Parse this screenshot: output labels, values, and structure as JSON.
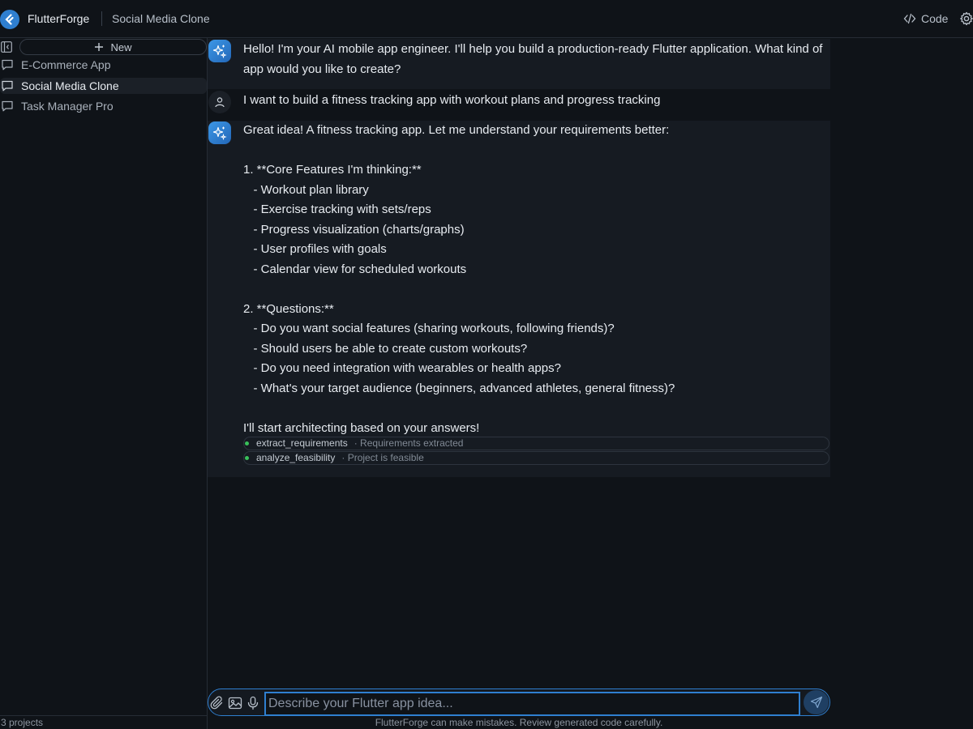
{
  "header": {
    "app_name": "FlutterForge",
    "project_title": "Social Media Clone",
    "code_label": "Code"
  },
  "sidebar": {
    "new_label": "New",
    "projects": [
      {
        "label": "E-Commerce App",
        "active": false
      },
      {
        "label": "Social Media Clone",
        "active": true
      },
      {
        "label": "Task Manager Pro",
        "active": false
      }
    ],
    "footer": "3 projects"
  },
  "messages": [
    {
      "role": "ai",
      "text": "Hello! I'm your AI mobile app engineer. I'll help you build a production-ready Flutter application. What kind of app would you like to create?"
    },
    {
      "role": "user",
      "text": "I want to build a fitness tracking app with workout plans and progress tracking"
    },
    {
      "role": "ai",
      "text": "Great idea! A fitness tracking app. Let me understand your requirements better:\n\n1. **Core Features I'm thinking:**\n   - Workout plan library\n   - Exercise tracking with sets/reps\n   - Progress visualization (charts/graphs)\n   - User profiles with goals\n   - Calendar view for scheduled workouts\n\n2. **Questions:**\n   - Do you want social features (sharing workouts, following friends)?\n   - Should users be able to create custom workouts?\n   - Do you need integration with wearables or health apps?\n   - What's your target audience (beginners, advanced athletes, general fitness)?\n\nI'll start architecting based on your answers!"
    }
  ],
  "tools": [
    {
      "name": "extract_requirements",
      "result": "· Requirements extracted"
    },
    {
      "name": "analyze_feasibility",
      "result": "· Project is feasible"
    }
  ],
  "composer": {
    "placeholder": "Describe your Flutter app idea...",
    "value": ""
  },
  "disclaimer": "FlutterForge can make mistakes. Review generated code carefully.",
  "colors": {
    "accent": "#2f7fd0",
    "background": "#0f1318",
    "ai_bubble": "#161b22",
    "status_green": "#39c15a"
  }
}
